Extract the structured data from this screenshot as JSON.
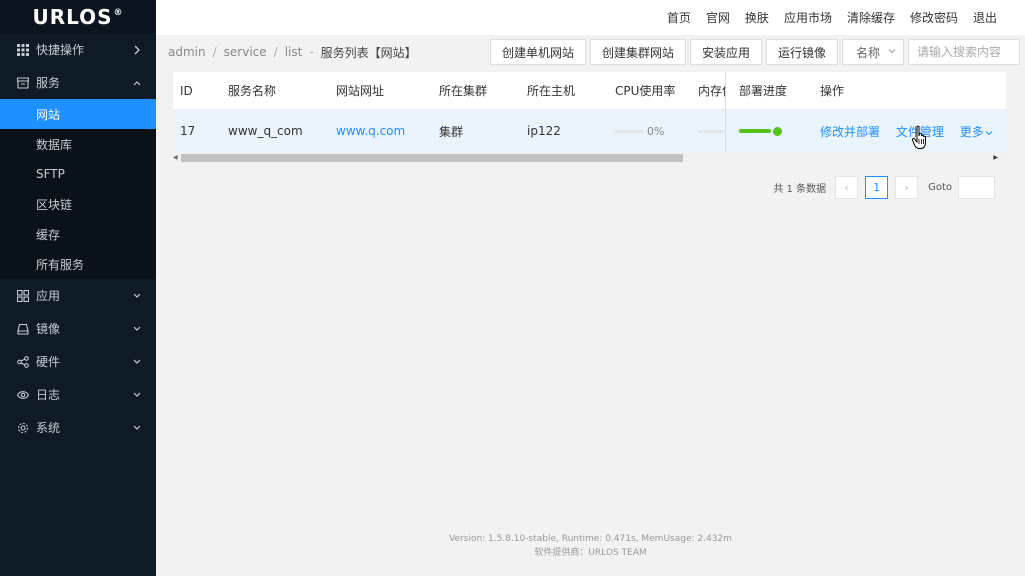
{
  "app": {
    "logo": "URLOS",
    "logo_mark": "®"
  },
  "topnav": [
    "首页",
    "官网",
    "换肤",
    "应用市场",
    "清除缓存",
    "修改密码",
    "退出"
  ],
  "sidebar": {
    "groups": [
      {
        "label": "快捷操作",
        "icon": "grid-icon",
        "arrow": "right"
      },
      {
        "label": "服务",
        "icon": "store-icon",
        "arrow": "up",
        "items": [
          "网站",
          "数据库",
          "SFTP",
          "区块链",
          "缓存",
          "所有服务"
        ],
        "active_item": "网站"
      },
      {
        "label": "应用",
        "icon": "apps-icon",
        "arrow": "down"
      },
      {
        "label": "镜像",
        "icon": "disk-icon",
        "arrow": "down"
      },
      {
        "label": "硬件",
        "icon": "share-icon",
        "arrow": "down"
      },
      {
        "label": "日志",
        "icon": "eye-icon",
        "arrow": "down"
      },
      {
        "label": "系统",
        "icon": "gear-icon",
        "arrow": "down"
      }
    ]
  },
  "breadcrumb": {
    "parts": [
      "admin",
      "service",
      "list"
    ],
    "dash": "-",
    "current": "服务列表【网站】"
  },
  "toolbar": {
    "buttons": [
      "创建单机网站",
      "创建集群网站",
      "安装应用",
      "运行镜像"
    ],
    "select_value": "名称",
    "search_placeholder": "请输入搜索内容"
  },
  "table": {
    "columns": [
      "ID",
      "服务名称",
      "网站网址",
      "所在集群",
      "所在主机",
      "CPU使用率",
      "内存使",
      "部署进度",
      "操作"
    ],
    "rows": [
      {
        "id": "17",
        "name": "www_q_com",
        "url": "www.q.com",
        "cluster": "集群",
        "host": "ip122",
        "cpu": "0%",
        "cpu_value": 0,
        "mem_value": 0,
        "deploy_value": 1,
        "ops": [
          "修改并部署",
          "文件管理",
          "更多"
        ]
      }
    ]
  },
  "pagination": {
    "total_text": "共 1 条数据",
    "current_page": "1",
    "prev": "‹",
    "next": "›",
    "goto_label": "Goto"
  },
  "footer": {
    "line1": "Version: 1.5.8.10-stable,   Runtime: 0.471s,   MemUsage: 2.432m",
    "line2": "软件提供商：URLOS TEAM"
  },
  "colors": {
    "sidebar_bg": "#0e1a26",
    "active": "#1e90ff",
    "link": "#1e90ff",
    "success": "#52c41a"
  }
}
